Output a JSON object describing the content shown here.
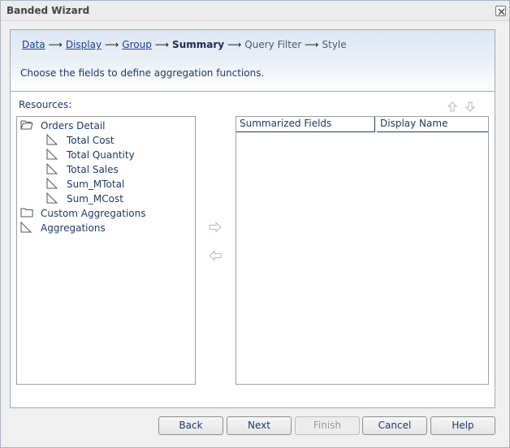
{
  "window": {
    "title": "Banded Wizard"
  },
  "icons": {
    "close": "close-icon",
    "folder_open": "folder-open-icon",
    "folder": "folder-icon",
    "field": "field-icon",
    "move_right": "arrow-right-icon",
    "move_left": "arrow-left-icon",
    "move_up": "arrow-up-icon",
    "move_down": "arrow-down-icon"
  },
  "breadcrumb": {
    "arrow": "⟶",
    "data": "Data",
    "display": "Display",
    "group": "Group",
    "summary": "Summary",
    "query_filter": "Query Filter",
    "style": "Style"
  },
  "instruction": "Choose the fields to define aggregation functions.",
  "resources": {
    "label": "Resources:",
    "tree": {
      "orders_detail": "Orders Detail",
      "children": [
        "Total Cost",
        "Total Quantity",
        "Total Sales",
        "Sum_MTotal",
        "Sum_MCost"
      ],
      "custom_aggregations": "Custom Aggregations",
      "aggregations": "Aggregations"
    }
  },
  "summary_table": {
    "columns": [
      "Summarized Fields",
      "Display Name"
    ]
  },
  "buttons": {
    "back": "Back",
    "next": "Next",
    "finish": "Finish",
    "cancel": "Cancel",
    "help": "Help"
  }
}
